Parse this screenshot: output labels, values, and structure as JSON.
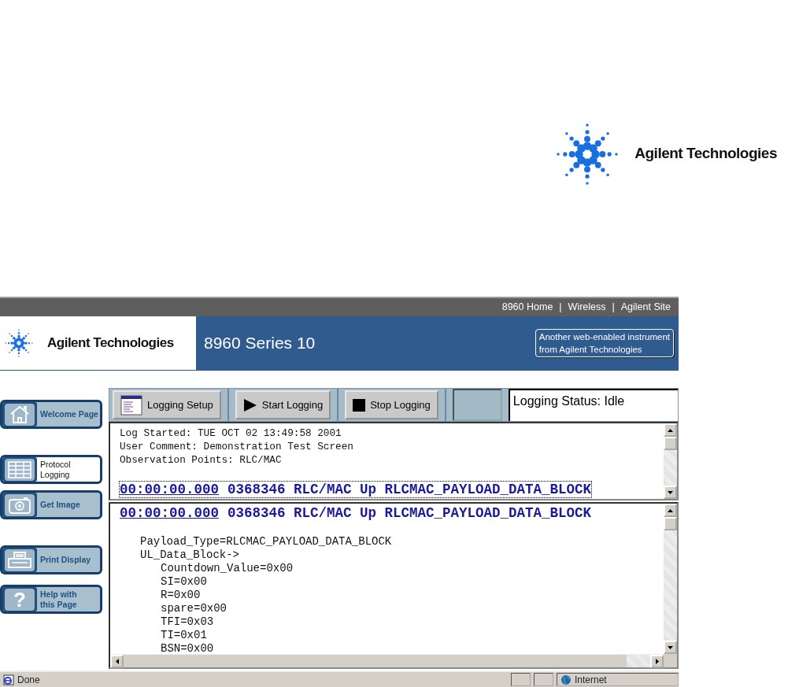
{
  "document_header": {
    "logo_text": "Agilent Technologies"
  },
  "browser": {
    "top_links": {
      "separator": "|",
      "items": [
        "8960 Home",
        "Wireless",
        "Agilent Site"
      ]
    },
    "banner": {
      "logo_text": "Agilent Technologies",
      "title": "8960 Series 10",
      "badge_lines": [
        "Another web-enabled instrument",
        "from Agilent Technologies"
      ]
    },
    "nav": [
      {
        "label": "Welcome Page",
        "kind": "home",
        "selected": false
      },
      {
        "label": "Protocol\nLogging",
        "kind": "table",
        "selected": true
      },
      {
        "label": "Get Image",
        "kind": "camera",
        "selected": false
      },
      {
        "label": "Print Display",
        "kind": "printer",
        "selected": false
      },
      {
        "label": "Help with\nthis Page",
        "kind": "help",
        "glyph": "?",
        "selected": false
      }
    ],
    "toolbar": {
      "buttons": [
        {
          "label": "Logging Setup",
          "kind": "window"
        },
        {
          "label": "Start Logging",
          "kind": "play"
        },
        {
          "label": "Stop Logging",
          "kind": "stop"
        }
      ],
      "status": "Logging Status: Idle"
    },
    "summary_pane": {
      "lines": [
        "Log Started: TUE OCT 02 13:49:58 2001",
        "User Comment: Demonstration Test Screen",
        "Observation Points: RLC/MAC"
      ],
      "entry": {
        "time": "00:00:00.000",
        "text": "0368346 RLC/MAC Up RLCMAC_PAYLOAD_DATA_BLOCK",
        "focused": true
      }
    },
    "detail_pane": {
      "entry": {
        "time": "00:00:00.000",
        "text": "0368346 RLC/MAC Up RLCMAC_PAYLOAD_DATA_BLOCK",
        "focused": false
      },
      "fields": [
        {
          "text": "Payload_Type=RLCMAC_PAYLOAD_DATA_BLOCK"
        },
        {
          "text": "UL_Data_Block->",
          "children": [
            {
              "text": "Countdown_Value=0x00"
            },
            {
              "text": "SI=0x00"
            },
            {
              "text": "R=0x00"
            },
            {
              "text": "spare=0x00"
            },
            {
              "text": "TFI=0x03"
            },
            {
              "text": "TI=0x01"
            },
            {
              "text": "BSN=0x00"
            }
          ]
        }
      ]
    },
    "status_bar": {
      "text": "Done",
      "zone": "Internet"
    }
  }
}
